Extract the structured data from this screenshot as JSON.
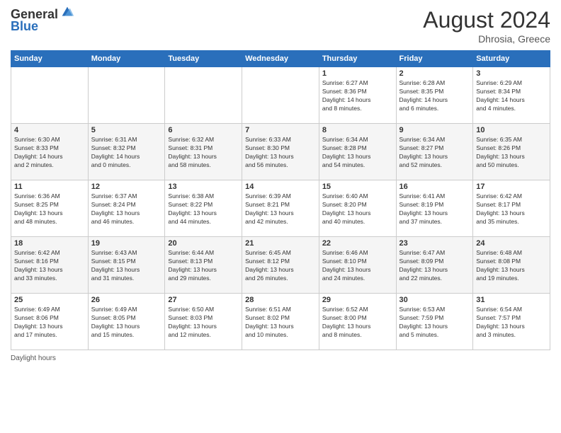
{
  "header": {
    "logo_line1": "General",
    "logo_line2": "Blue",
    "month_title": "August 2024",
    "subtitle": "Dhrosia, Greece"
  },
  "days_of_week": [
    "Sunday",
    "Monday",
    "Tuesday",
    "Wednesday",
    "Thursday",
    "Friday",
    "Saturday"
  ],
  "weeks": [
    [
      {
        "day": "",
        "info": ""
      },
      {
        "day": "",
        "info": ""
      },
      {
        "day": "",
        "info": ""
      },
      {
        "day": "",
        "info": ""
      },
      {
        "day": "1",
        "info": "Sunrise: 6:27 AM\nSunset: 8:36 PM\nDaylight: 14 hours\nand 8 minutes."
      },
      {
        "day": "2",
        "info": "Sunrise: 6:28 AM\nSunset: 8:35 PM\nDaylight: 14 hours\nand 6 minutes."
      },
      {
        "day": "3",
        "info": "Sunrise: 6:29 AM\nSunset: 8:34 PM\nDaylight: 14 hours\nand 4 minutes."
      }
    ],
    [
      {
        "day": "4",
        "info": "Sunrise: 6:30 AM\nSunset: 8:33 PM\nDaylight: 14 hours\nand 2 minutes."
      },
      {
        "day": "5",
        "info": "Sunrise: 6:31 AM\nSunset: 8:32 PM\nDaylight: 14 hours\nand 0 minutes."
      },
      {
        "day": "6",
        "info": "Sunrise: 6:32 AM\nSunset: 8:31 PM\nDaylight: 13 hours\nand 58 minutes."
      },
      {
        "day": "7",
        "info": "Sunrise: 6:33 AM\nSunset: 8:30 PM\nDaylight: 13 hours\nand 56 minutes."
      },
      {
        "day": "8",
        "info": "Sunrise: 6:34 AM\nSunset: 8:28 PM\nDaylight: 13 hours\nand 54 minutes."
      },
      {
        "day": "9",
        "info": "Sunrise: 6:34 AM\nSunset: 8:27 PM\nDaylight: 13 hours\nand 52 minutes."
      },
      {
        "day": "10",
        "info": "Sunrise: 6:35 AM\nSunset: 8:26 PM\nDaylight: 13 hours\nand 50 minutes."
      }
    ],
    [
      {
        "day": "11",
        "info": "Sunrise: 6:36 AM\nSunset: 8:25 PM\nDaylight: 13 hours\nand 48 minutes."
      },
      {
        "day": "12",
        "info": "Sunrise: 6:37 AM\nSunset: 8:24 PM\nDaylight: 13 hours\nand 46 minutes."
      },
      {
        "day": "13",
        "info": "Sunrise: 6:38 AM\nSunset: 8:22 PM\nDaylight: 13 hours\nand 44 minutes."
      },
      {
        "day": "14",
        "info": "Sunrise: 6:39 AM\nSunset: 8:21 PM\nDaylight: 13 hours\nand 42 minutes."
      },
      {
        "day": "15",
        "info": "Sunrise: 6:40 AM\nSunset: 8:20 PM\nDaylight: 13 hours\nand 40 minutes."
      },
      {
        "day": "16",
        "info": "Sunrise: 6:41 AM\nSunset: 8:19 PM\nDaylight: 13 hours\nand 37 minutes."
      },
      {
        "day": "17",
        "info": "Sunrise: 6:42 AM\nSunset: 8:17 PM\nDaylight: 13 hours\nand 35 minutes."
      }
    ],
    [
      {
        "day": "18",
        "info": "Sunrise: 6:42 AM\nSunset: 8:16 PM\nDaylight: 13 hours\nand 33 minutes."
      },
      {
        "day": "19",
        "info": "Sunrise: 6:43 AM\nSunset: 8:15 PM\nDaylight: 13 hours\nand 31 minutes."
      },
      {
        "day": "20",
        "info": "Sunrise: 6:44 AM\nSunset: 8:13 PM\nDaylight: 13 hours\nand 29 minutes."
      },
      {
        "day": "21",
        "info": "Sunrise: 6:45 AM\nSunset: 8:12 PM\nDaylight: 13 hours\nand 26 minutes."
      },
      {
        "day": "22",
        "info": "Sunrise: 6:46 AM\nSunset: 8:10 PM\nDaylight: 13 hours\nand 24 minutes."
      },
      {
        "day": "23",
        "info": "Sunrise: 6:47 AM\nSunset: 8:09 PM\nDaylight: 13 hours\nand 22 minutes."
      },
      {
        "day": "24",
        "info": "Sunrise: 6:48 AM\nSunset: 8:08 PM\nDaylight: 13 hours\nand 19 minutes."
      }
    ],
    [
      {
        "day": "25",
        "info": "Sunrise: 6:49 AM\nSunset: 8:06 PM\nDaylight: 13 hours\nand 17 minutes."
      },
      {
        "day": "26",
        "info": "Sunrise: 6:49 AM\nSunset: 8:05 PM\nDaylight: 13 hours\nand 15 minutes."
      },
      {
        "day": "27",
        "info": "Sunrise: 6:50 AM\nSunset: 8:03 PM\nDaylight: 13 hours\nand 12 minutes."
      },
      {
        "day": "28",
        "info": "Sunrise: 6:51 AM\nSunset: 8:02 PM\nDaylight: 13 hours\nand 10 minutes."
      },
      {
        "day": "29",
        "info": "Sunrise: 6:52 AM\nSunset: 8:00 PM\nDaylight: 13 hours\nand 8 minutes."
      },
      {
        "day": "30",
        "info": "Sunrise: 6:53 AM\nSunset: 7:59 PM\nDaylight: 13 hours\nand 5 minutes."
      },
      {
        "day": "31",
        "info": "Sunrise: 6:54 AM\nSunset: 7:57 PM\nDaylight: 13 hours\nand 3 minutes."
      }
    ]
  ],
  "footer": {
    "daylight_label": "Daylight hours"
  }
}
